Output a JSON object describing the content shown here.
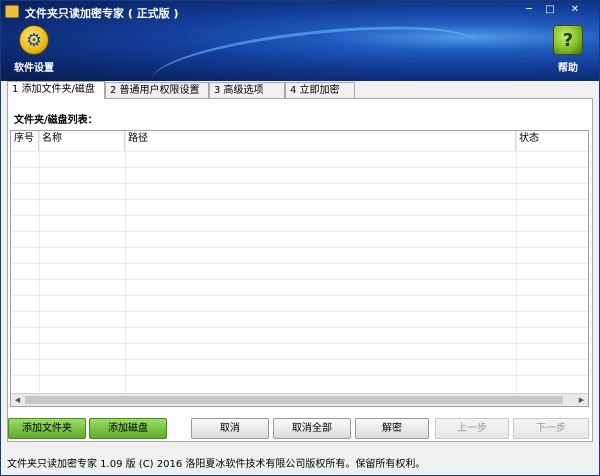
{
  "window": {
    "title": "文件夹只读加密专家 ( 正式版 )",
    "minimize": "─",
    "maximize": "□",
    "close": "✕"
  },
  "toolbar": {
    "settings_label": "软件设置",
    "settings_icon": "gear-icon",
    "help_label": "帮助",
    "help_icon": "?"
  },
  "tabs": [
    {
      "label": "1 添加文件夹/磁盘",
      "active": true
    },
    {
      "label": "2 普通用户权限设置",
      "active": false
    },
    {
      "label": "3 高级选项",
      "active": false
    },
    {
      "label": "4 立即加密",
      "active": false
    }
  ],
  "list": {
    "title": "文件夹/磁盘列表：",
    "columns": [
      "序号",
      "名称",
      "路径",
      "状态"
    ],
    "rows": []
  },
  "buttons": {
    "add_folder": "添加文件夹",
    "add_disk": "添加磁盘",
    "cancel": "取消",
    "cancel_all": "取消全部",
    "decrypt": "解密",
    "prev": "上一步",
    "next": "下一步"
  },
  "status": "文件夹只读加密专家 1.09 版 (C) 2016 洛阳夏冰软件技术有限公司版权所有。保留所有权利。",
  "colors": {
    "header_dark": "#0a2668",
    "header_light": "#4f9be6",
    "green_button": "#5fa92a"
  }
}
